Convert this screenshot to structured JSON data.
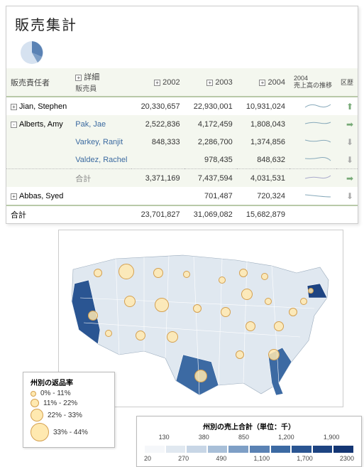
{
  "title": "販売集計",
  "headers": {
    "manager": "販売責任者",
    "detail": "詳細",
    "salesperson": "販売員",
    "y2002": "2002",
    "y2003": "2003",
    "y2004": "2004",
    "hist": "2004\n売上高の推移",
    "last": "区歴"
  },
  "rows": [
    {
      "type": "mgr",
      "name": "Jian, Stephen",
      "exp": "+",
      "v2002": "20,330,657",
      "v2003": "22,930,001",
      "v2004": "10,931,024",
      "trend": "up"
    },
    {
      "type": "mgr",
      "name": "Alberts, Amy",
      "exp": "-",
      "sp": "Pak, Jae",
      "v2002": "2,522,836",
      "v2003": "4,172,459",
      "v2004": "1,808,043",
      "trend": "rt"
    },
    {
      "type": "sp",
      "sp": "Varkey, Ranjit",
      "v2002": "848,333",
      "v2003": "2,286,700",
      "v2004": "1,374,856",
      "trend": "dn"
    },
    {
      "type": "sp",
      "sp": "Valdez, Rachel",
      "v2002": "",
      "v2003": "978,435",
      "v2004": "848,632",
      "trend": "dn"
    },
    {
      "type": "sub",
      "sp": "合計",
      "v2002": "3,371,169",
      "v2003": "7,437,594",
      "v2004": "4,031,531",
      "trend": "rt"
    },
    {
      "type": "mgr",
      "name": "Abbas, Syed",
      "exp": "+",
      "v2002": "",
      "v2003": "701,487",
      "v2004": "720,324",
      "trend": "dn"
    }
  ],
  "total": {
    "label": "合計",
    "v2002": "23,701,827",
    "v2003": "31,069,082",
    "v2004": "15,682,879"
  },
  "legend1": {
    "title": "州別の返品率",
    "items": [
      {
        "size": 8,
        "label": "0% - 11%"
      },
      {
        "size": 12,
        "label": "11% - 22%"
      },
      {
        "size": 18,
        "label": "22% - 33%"
      },
      {
        "size": 26,
        "label": "33% - 44%"
      }
    ]
  },
  "legend2": {
    "title": "州別の売上合計（単位：千）",
    "ticks_top": [
      "130",
      "380",
      "850",
      "1,200",
      "1,900"
    ],
    "ticks_bot": [
      "20",
      "270",
      "490",
      "1,100",
      "1,700",
      "2300"
    ],
    "colors": [
      "#f5f7fa",
      "#e0e8f0",
      "#c8d6e6",
      "#a8bfd8",
      "#7e9fc6",
      "#5a82b4",
      "#3c6aa3",
      "#2a5592",
      "#1e4482",
      "#143674"
    ]
  },
  "chart_data": {
    "type": "map",
    "bubbles": "circle size = return rate bucket (0-44%)",
    "fill": "state fill color = total sales (20-2300, thousands)"
  }
}
